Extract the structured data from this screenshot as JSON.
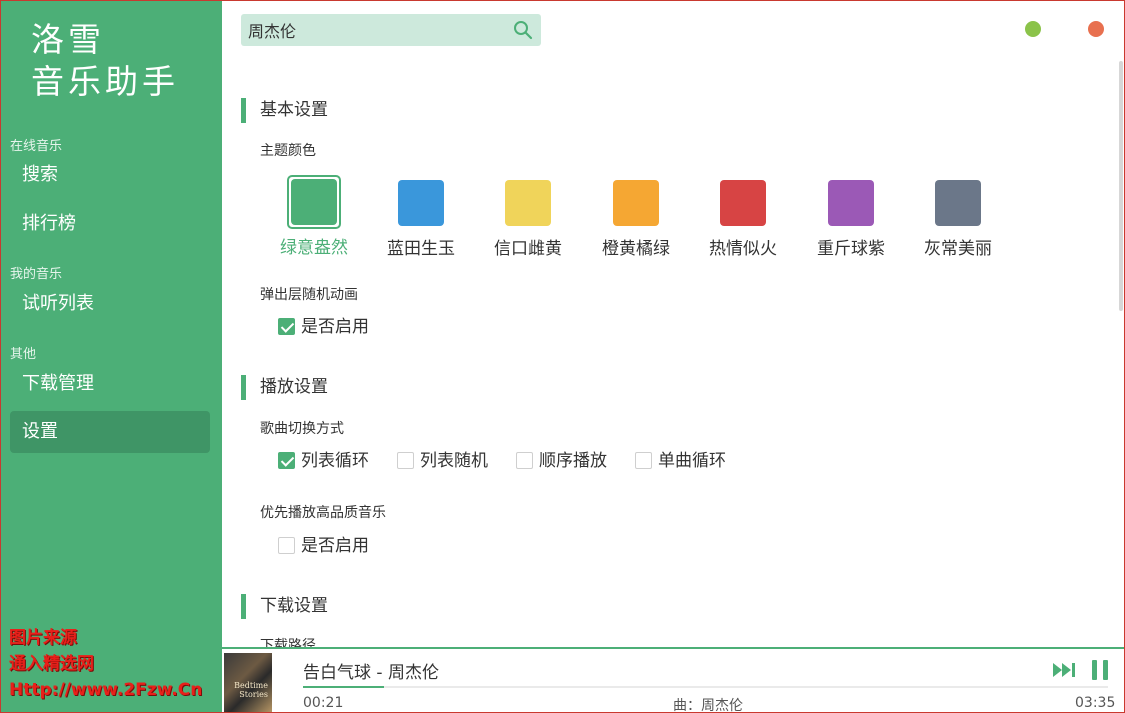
{
  "brand": {
    "line1": "洛雪",
    "line2": "音乐助手"
  },
  "nav": {
    "groups": [
      {
        "title": "在线音乐"
      },
      {
        "title": "我的音乐"
      },
      {
        "title": "其他"
      }
    ],
    "items": [
      {
        "label": "搜索"
      },
      {
        "label": "排行榜"
      },
      {
        "label": "试听列表"
      },
      {
        "label": "下载管理"
      },
      {
        "label": "设置",
        "active": true
      }
    ]
  },
  "watermark": {
    "line1": "图片来源",
    "line2": "通入精选网",
    "line3": "Http://www.2Fzw.Cn"
  },
  "search": {
    "value": "周杰伦",
    "placeholder": ""
  },
  "window_controls": {
    "minimize_color": "#8bc34a",
    "close_color": "#e8704f"
  },
  "settings": {
    "basic": {
      "title": "基本设置",
      "theme_label": "主题颜色",
      "themes": [
        {
          "name": "绿意盎然",
          "color": "#4caf77",
          "selected": true
        },
        {
          "name": "蓝田生玉",
          "color": "#3a97db"
        },
        {
          "name": "信口雌黄",
          "color": "#f0d45a"
        },
        {
          "name": "橙黄橘绿",
          "color": "#f5a733"
        },
        {
          "name": "热情似火",
          "color": "#d74444"
        },
        {
          "name": "重斤球紫",
          "color": "#9b59b6"
        },
        {
          "name": "灰常美丽",
          "color": "#6b7789"
        }
      ],
      "popup_anim_label": "弹出层随机动画",
      "popup_anim_option": "是否启用",
      "popup_anim_enabled": true
    },
    "playback": {
      "title": "播放设置",
      "switch_mode_label": "歌曲切换方式",
      "switch_modes": [
        {
          "label": "列表循环",
          "checked": true
        },
        {
          "label": "列表随机",
          "checked": false
        },
        {
          "label": "顺序播放",
          "checked": false
        },
        {
          "label": "单曲循环",
          "checked": false
        }
      ],
      "hq_label": "优先播放高品质音乐",
      "hq_option": "是否启用",
      "hq_enabled": false
    },
    "download": {
      "title": "下载设置",
      "path_label": "下载路径"
    }
  },
  "player": {
    "title": "告白气球 - 周杰伦",
    "current_time": "00:21",
    "meta": "曲：周杰伦",
    "total_time": "03:35",
    "progress": 0.1,
    "cover_caption": "Bedtime Stories"
  },
  "colors": {
    "accent": "#4caf77",
    "sidebar": "#4caf77",
    "sidebar_active": "#3f9566"
  }
}
